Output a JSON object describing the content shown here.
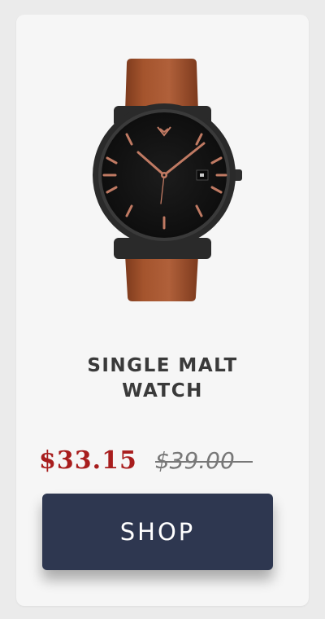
{
  "product": {
    "title_line1": "SINGLE MALT",
    "title_line2": "WATCH",
    "sale_price": "$33.15",
    "original_price": "$39.00",
    "image_description": "watch-image"
  },
  "actions": {
    "shop_label": "SHOP"
  },
  "colors": {
    "sale_price": "#a81d1d",
    "original_price": "#777777",
    "button_bg": "#2e3750",
    "card_bg": "#f6f6f6",
    "strap": "#a4542d",
    "dial": "#141414",
    "accents": "#c07a63"
  }
}
